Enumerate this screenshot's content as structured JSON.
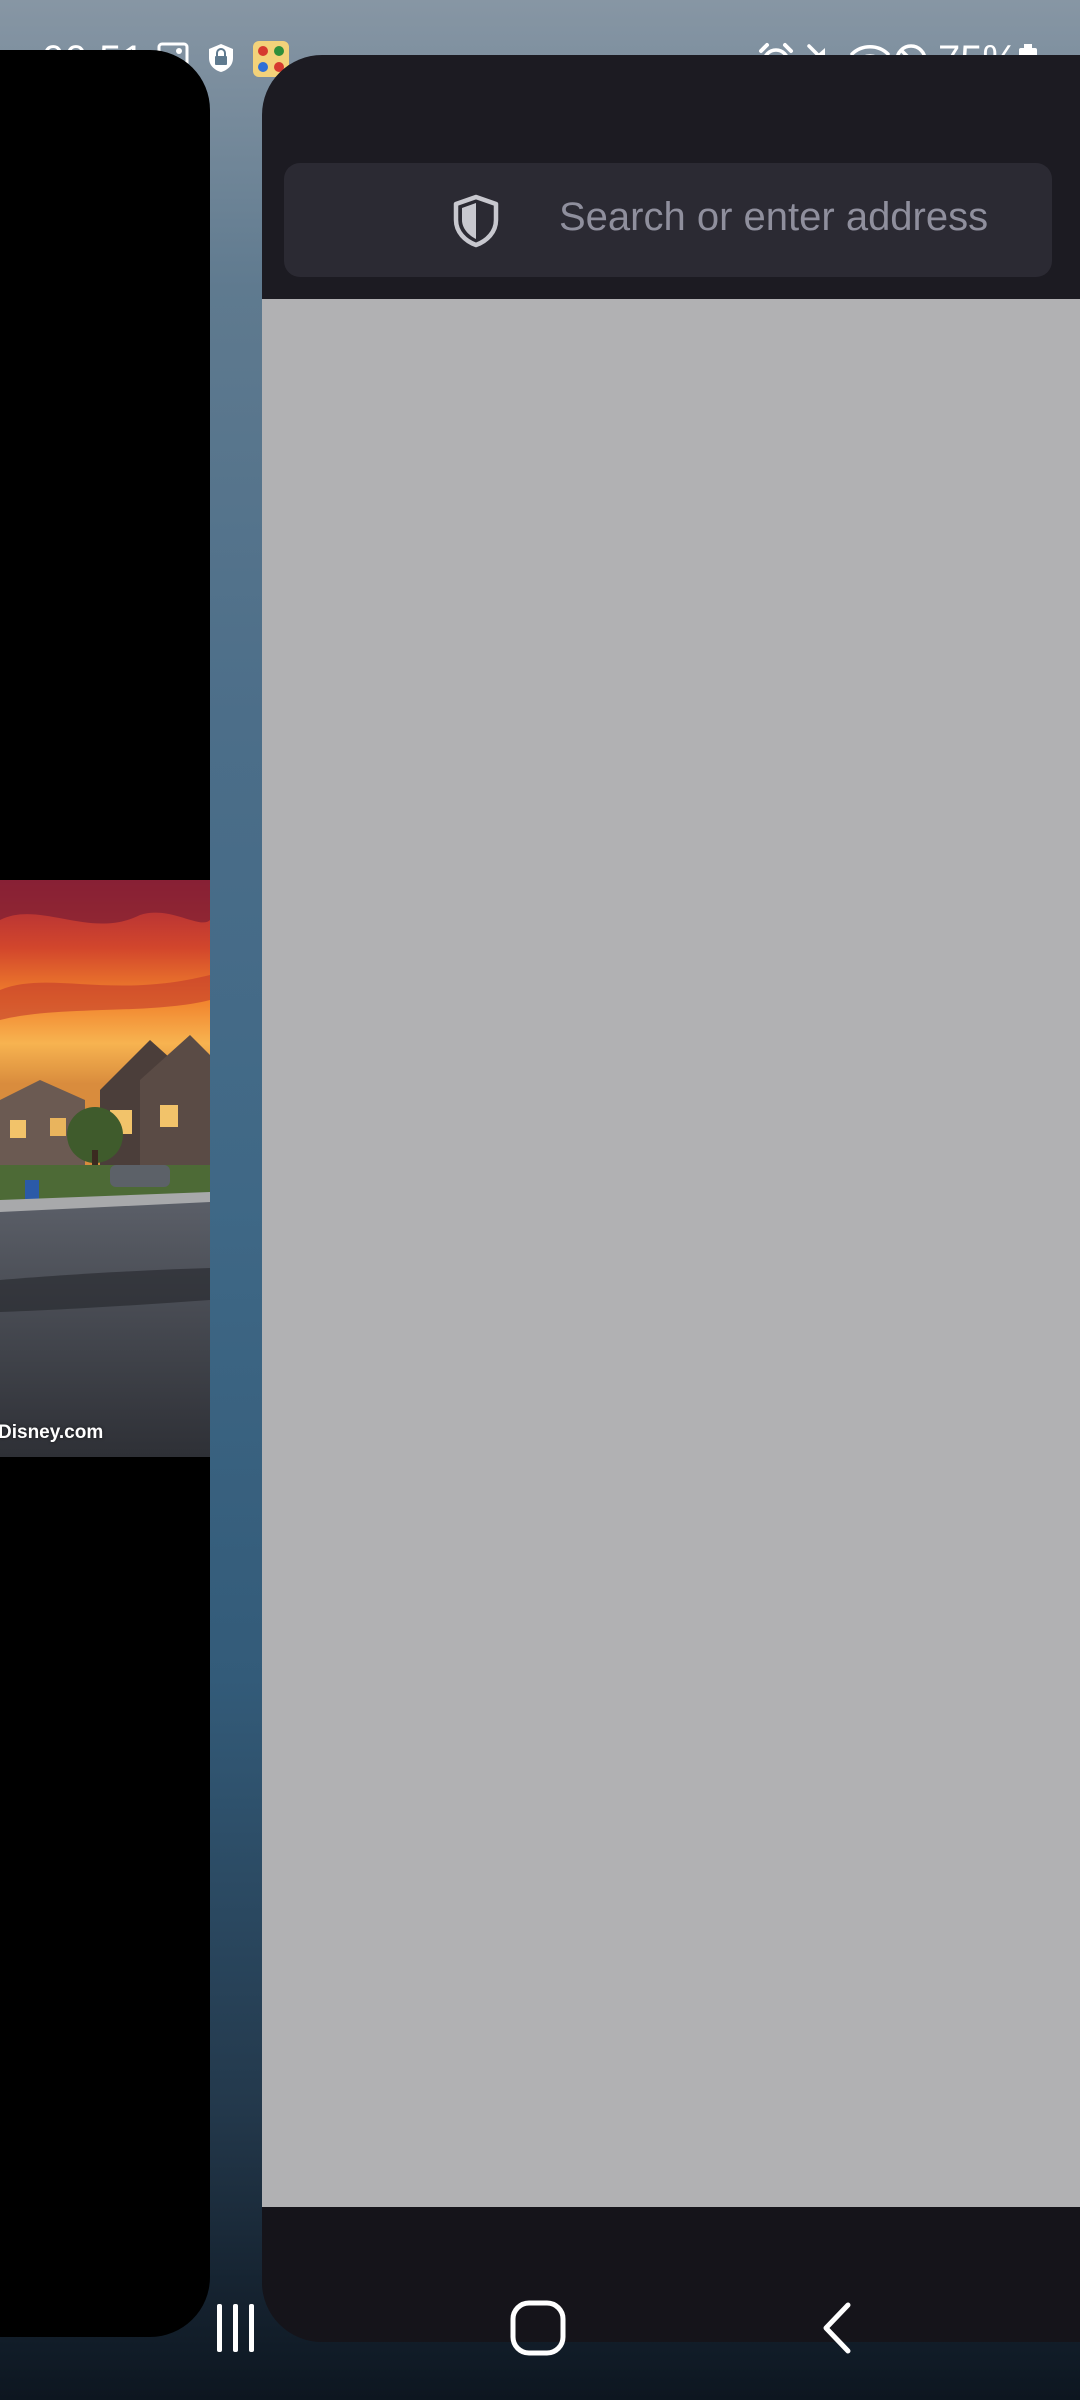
{
  "status_bar": {
    "time": "00:51",
    "battery_percent": "75%",
    "notification_icons": [
      "gallery-icon",
      "vpn-lock-icon",
      "game-app-icon",
      "notification-dot-icon"
    ],
    "system_icons": [
      "alarm-icon",
      "mute-icon",
      "wifi-icon",
      "do-not-disturb-icon",
      "battery-icon"
    ]
  },
  "recent_apps": {
    "left_card": {
      "thumbnail_watermark": "Disney.com"
    },
    "browser_card": {
      "url_placeholder": "Search or enter address",
      "url_icon": "shield-icon",
      "content_color": "#b1b1b3",
      "toolbar_color": "#1c1b22"
    }
  },
  "nav_bar": {
    "buttons": [
      "recents-button",
      "home-button",
      "back-button"
    ]
  }
}
